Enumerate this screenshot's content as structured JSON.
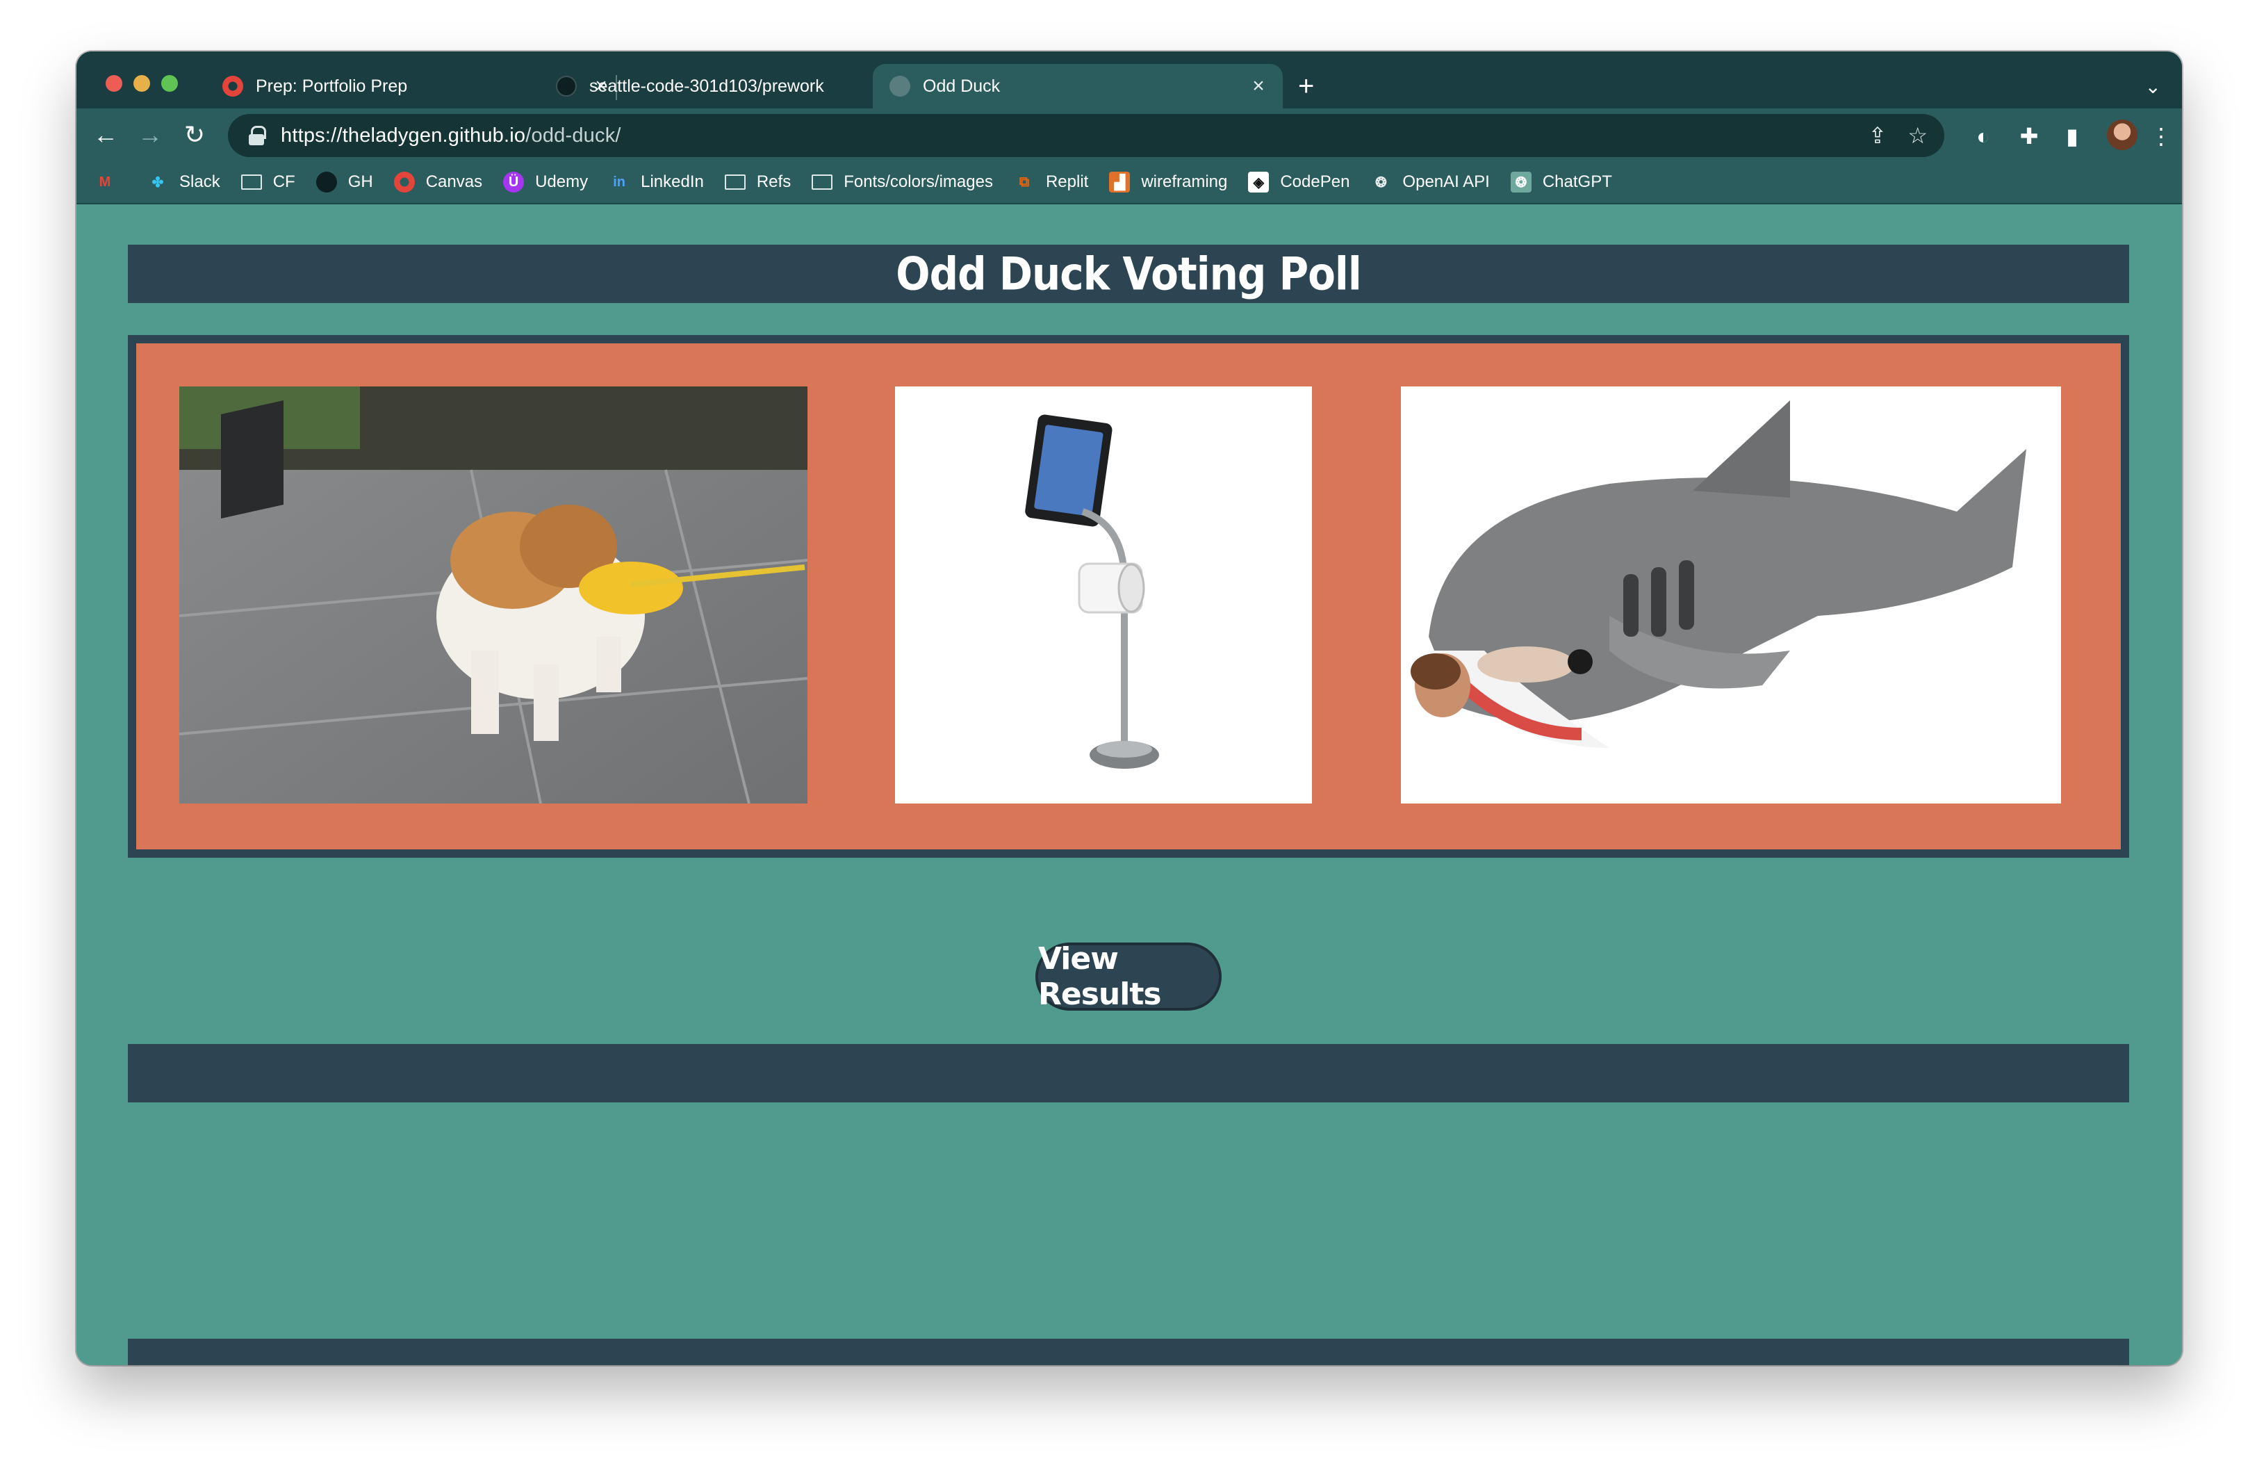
{
  "browser": {
    "tabs": [
      {
        "title": "Prep: Portfolio Prep",
        "favicon": "canvas-icon",
        "active": false
      },
      {
        "title": "seattle-code-301d103/prework",
        "favicon": "github-icon",
        "active": false
      },
      {
        "title": "Odd Duck",
        "favicon": "globe-icon",
        "active": true
      }
    ],
    "url_host": "https://theladygen.github.io",
    "url_path": "/odd-duck/",
    "bookmarks": [
      {
        "label": "",
        "icon": "gmail-icon"
      },
      {
        "label": "Slack",
        "icon": "slack-icon"
      },
      {
        "label": "CF",
        "icon": "folder-icon"
      },
      {
        "label": "GH",
        "icon": "github-icon"
      },
      {
        "label": "Canvas",
        "icon": "canvas-icon"
      },
      {
        "label": "Udemy",
        "icon": "udemy-icon"
      },
      {
        "label": "LinkedIn",
        "icon": "linkedin-icon"
      },
      {
        "label": "Refs",
        "icon": "folder-icon"
      },
      {
        "label": "Fonts/colors/images",
        "icon": "folder-icon"
      },
      {
        "label": "Replit",
        "icon": "replit-icon"
      },
      {
        "label": "wireframing",
        "icon": "balsamiq-icon"
      },
      {
        "label": "CodePen",
        "icon": "codepen-icon"
      },
      {
        "label": "OpenAI API",
        "icon": "openai-icon"
      },
      {
        "label": "ChatGPT",
        "icon": "chatgpt-icon"
      }
    ]
  },
  "page": {
    "title": "Odd Duck Voting Poll",
    "view_results_label": "View Results",
    "products": [
      {
        "name": "dog-duck"
      },
      {
        "name": "pet-sweep-tablet-stand"
      },
      {
        "name": "shark-sleeping-bag"
      }
    ]
  },
  "colors": {
    "page_bg": "#509b8e",
    "bar": "#2d4452",
    "gallery_bg": "#d97658"
  }
}
